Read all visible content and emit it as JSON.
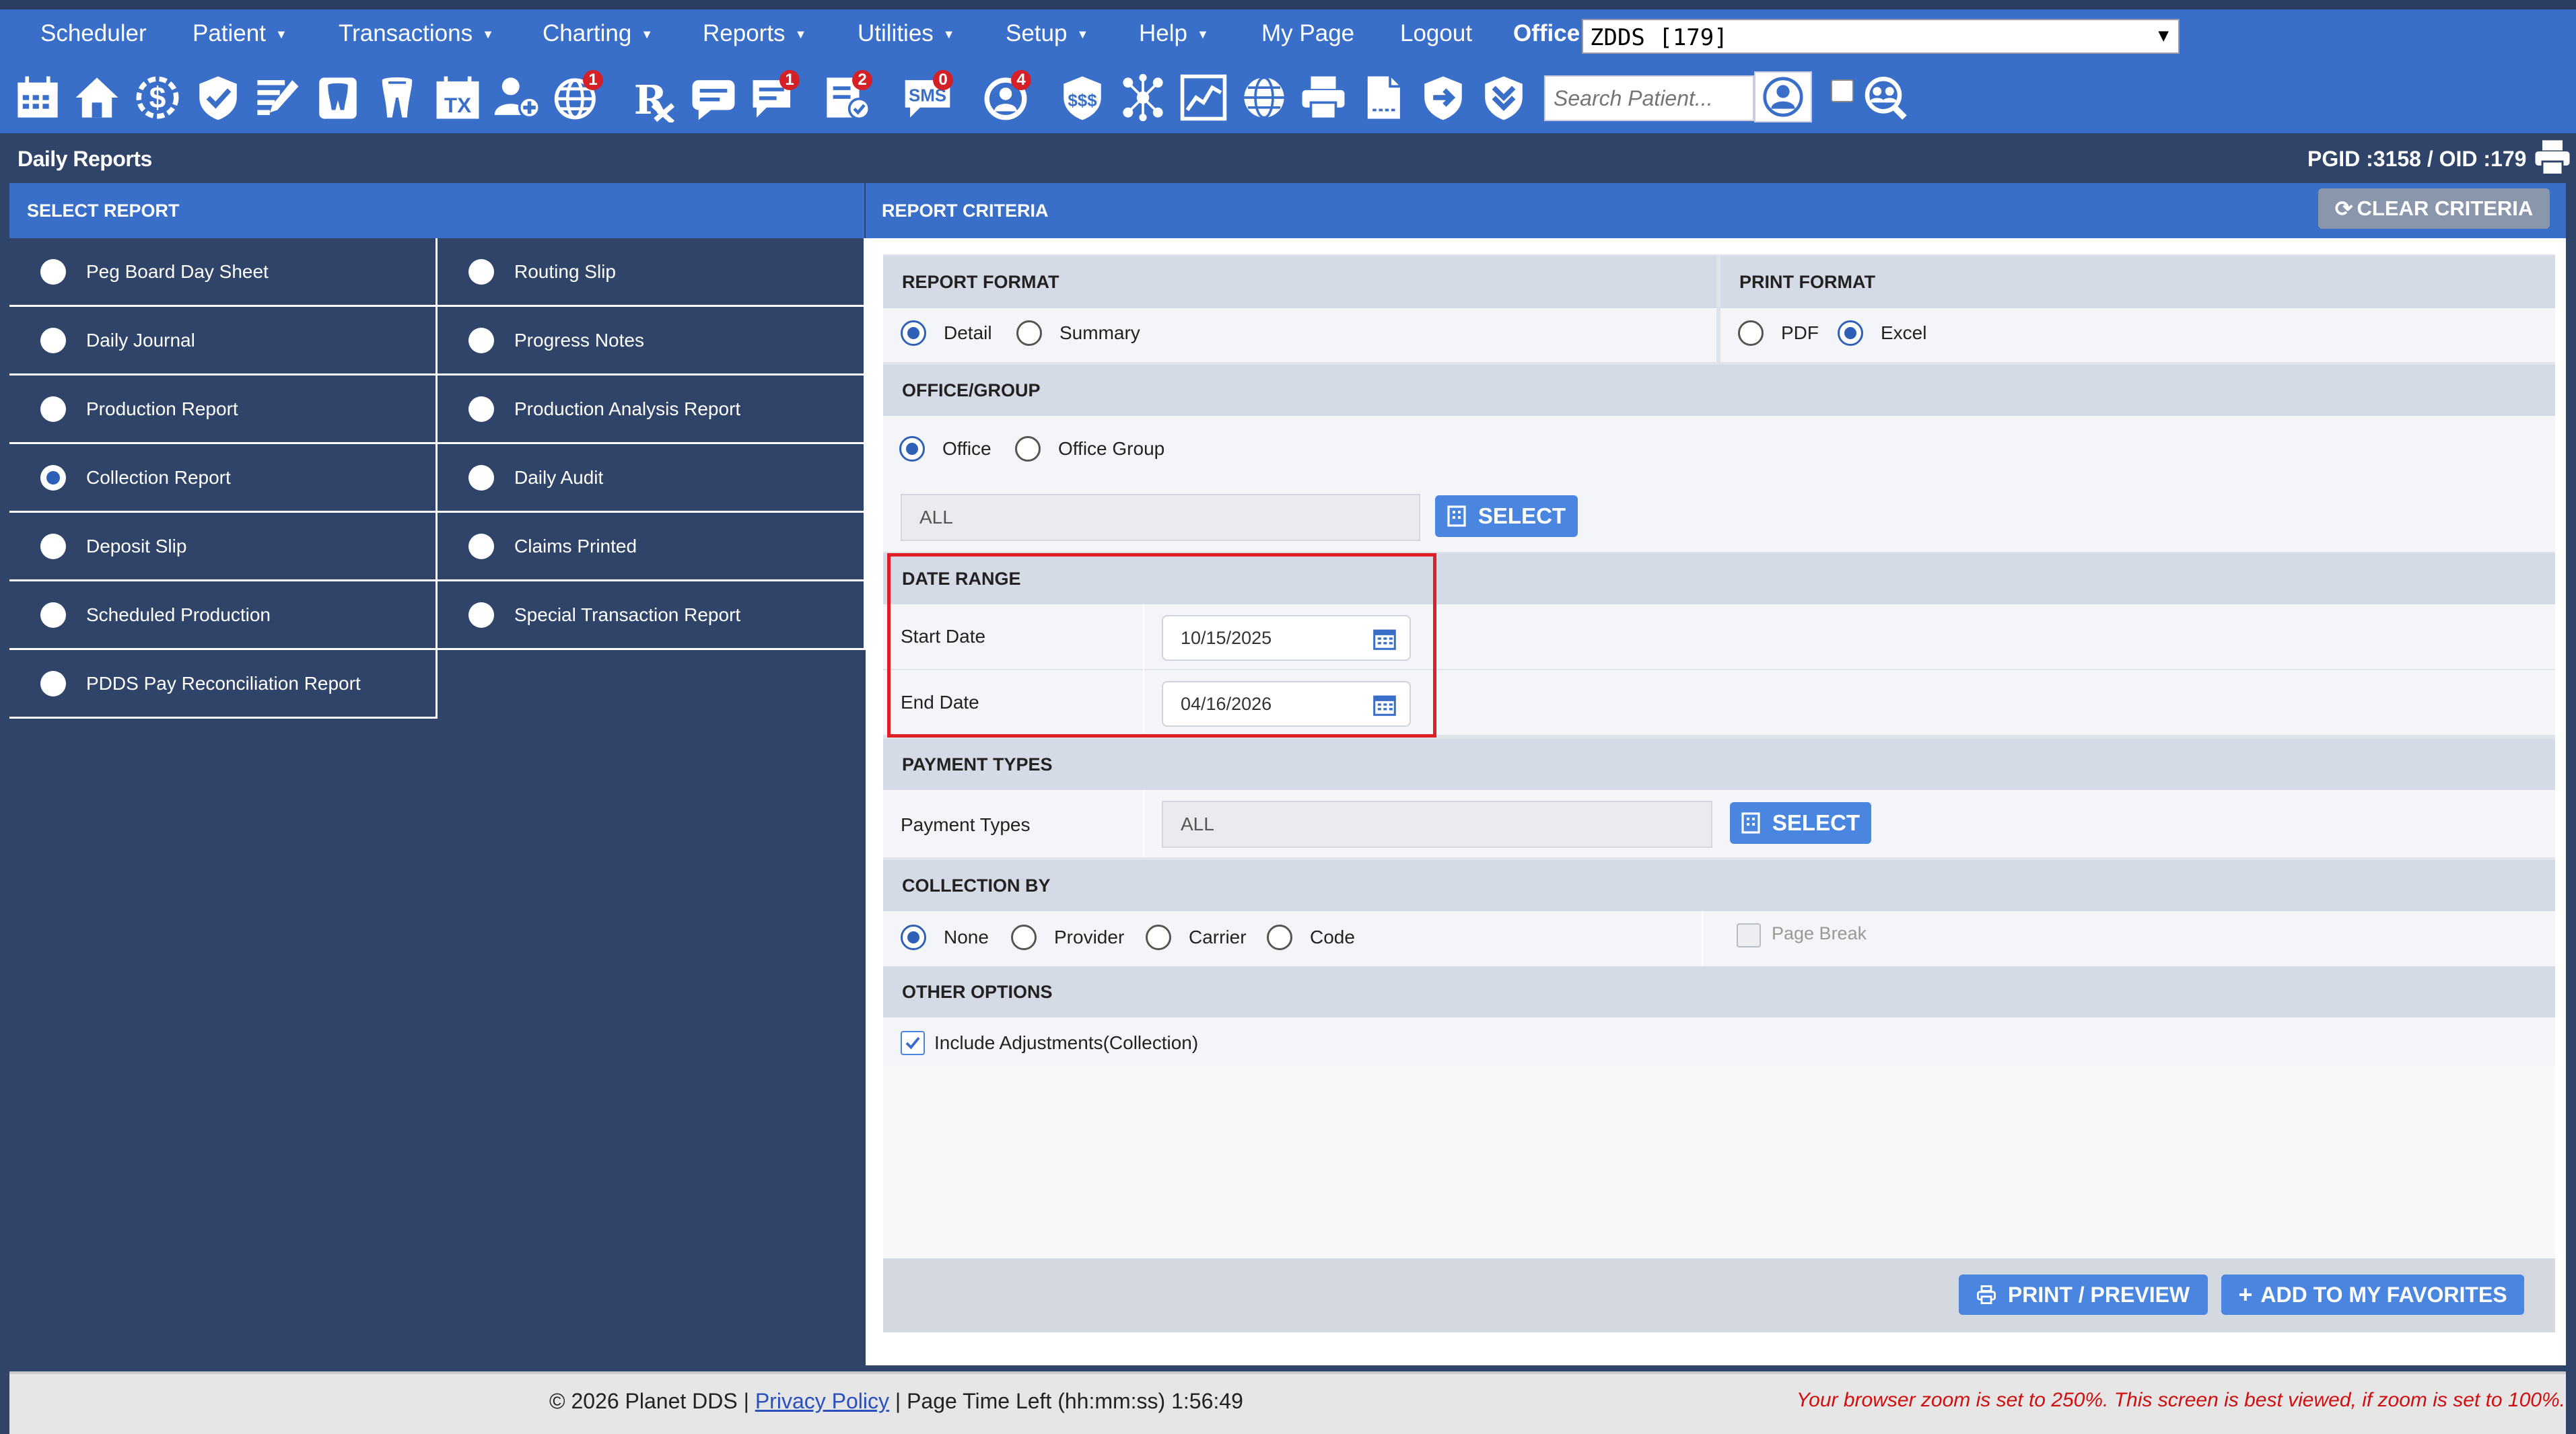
{
  "menu": {
    "items": [
      "Scheduler",
      "Patient",
      "Transactions",
      "Charting",
      "Reports",
      "Utilities",
      "Setup",
      "Help",
      "My Page",
      "Logout"
    ],
    "office_label": "Office",
    "office_value": "ZDDS [179]"
  },
  "toolbar": {
    "icons": [
      "calendar-icon",
      "home-icon",
      "dollar-icon",
      "shield-check-icon",
      "edit-icon",
      "tooth-icon",
      "tooth-roots-icon",
      "tx-calendar-icon",
      "add-user-icon",
      "globe-icon",
      "rx-icon",
      "message-icon",
      "chat-icon",
      "checklist-icon",
      "sms-icon",
      "recall-icon",
      "insurance-icon",
      "network-icon",
      "chart-icon",
      "globe-grid-icon",
      "printer-icon",
      "document-icon",
      "arrow-shield-icon",
      "chevrons-down-icon"
    ],
    "badges": {
      "globe": "1",
      "chat": "1",
      "checklist": "2",
      "sms": "0",
      "recall": "4"
    },
    "sms_text": "SMS",
    "tx_text": "TX",
    "search_placeholder": "Search Patient...",
    "accent": "#3a6fc9"
  },
  "title": {
    "page_title": "Daily Reports",
    "ids": "PGID :3158  /  OID :179"
  },
  "select_report": {
    "header": "SELECT REPORT",
    "reports": [
      {
        "label": "Peg Board Day Sheet",
        "checked": false
      },
      {
        "label": "Routing Slip",
        "checked": false
      },
      {
        "label": "Daily Journal",
        "checked": false
      },
      {
        "label": "Progress Notes",
        "checked": false
      },
      {
        "label": "Production Report",
        "checked": false
      },
      {
        "label": "Production Analysis Report",
        "checked": false
      },
      {
        "label": "Collection Report",
        "checked": true
      },
      {
        "label": "Daily Audit",
        "checked": false
      },
      {
        "label": "Deposit Slip",
        "checked": false
      },
      {
        "label": "Claims Printed",
        "checked": false
      },
      {
        "label": "Scheduled Production",
        "checked": false
      },
      {
        "label": "Special Transaction Report",
        "checked": false
      },
      {
        "label": "PDDS Pay Reconciliation Report",
        "checked": false
      }
    ]
  },
  "criteria": {
    "header": "REPORT CRITERIA",
    "clear_button": "CLEAR CRITERIA",
    "report_format": {
      "heading": "REPORT FORMAT",
      "options": [
        "Detail",
        "Summary"
      ],
      "selected": "Detail"
    },
    "print_format": {
      "heading": "PRINT FORMAT",
      "options": [
        "PDF",
        "Excel"
      ],
      "selected": "Excel"
    },
    "office_group": {
      "heading": "OFFICE/GROUP",
      "options": [
        "Office",
        "Office Group"
      ],
      "selected": "Office",
      "value": "ALL",
      "select_button": "SELECT"
    },
    "date_range": {
      "heading": "DATE RANGE",
      "start_label": "Start Date",
      "start_value": "10/15/2025",
      "end_label": "End Date",
      "end_value": "04/16/2026"
    },
    "payment_types": {
      "heading": "PAYMENT TYPES",
      "label": "Payment Types",
      "value": "ALL",
      "select_button": "SELECT"
    },
    "collection_by": {
      "heading": "COLLECTION BY",
      "options": [
        "None",
        "Provider",
        "Carrier",
        "Code"
      ],
      "selected": "None",
      "page_break": "Page Break"
    },
    "other_options": {
      "heading": "OTHER OPTIONS",
      "include_adjustments": "Include Adjustments(Collection)",
      "include_adjustments_checked": true
    },
    "print_button": "PRINT / PREVIEW",
    "favorites_button": "ADD TO MY FAVORITES"
  },
  "footer": {
    "copyright": "© 2026 Planet DDS |",
    "privacy": "Privacy Policy",
    "time_left": "|  Page Time Left (hh:mm:ss) 1:56:49",
    "zoom_warning": "Your browser zoom is set to 250%. This screen is best viewed, if zoom is set to 100%."
  }
}
